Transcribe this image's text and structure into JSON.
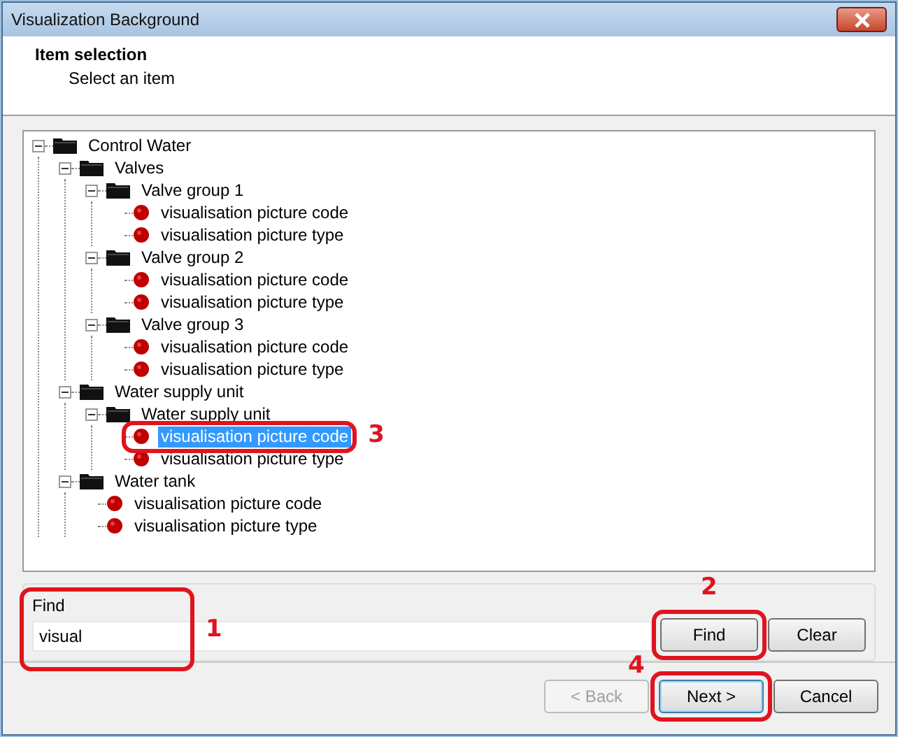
{
  "window": {
    "title": "Visualization Background"
  },
  "header": {
    "title": "Item selection",
    "subtitle": "Select an item"
  },
  "tree": [
    {
      "label": "Control Water",
      "kind": "folder",
      "expanded": true,
      "selected": false,
      "children": [
        {
          "label": "Valves",
          "kind": "folder",
          "expanded": true,
          "selected": false,
          "children": [
            {
              "label": "Valve group 1",
              "kind": "folder",
              "expanded": true,
              "selected": false,
              "children": [
                {
                  "label": "visualisation picture code",
                  "kind": "item",
                  "selected": false
                },
                {
                  "label": "visualisation picture type",
                  "kind": "item",
                  "selected": false
                }
              ]
            },
            {
              "label": "Valve group 2",
              "kind": "folder",
              "expanded": true,
              "selected": false,
              "children": [
                {
                  "label": "visualisation picture code",
                  "kind": "item",
                  "selected": false
                },
                {
                  "label": "visualisation picture type",
                  "kind": "item",
                  "selected": false
                }
              ]
            },
            {
              "label": "Valve group 3",
              "kind": "folder",
              "expanded": true,
              "selected": false,
              "children": [
                {
                  "label": "visualisation picture code",
                  "kind": "item",
                  "selected": false
                },
                {
                  "label": "visualisation picture type",
                  "kind": "item",
                  "selected": false
                }
              ]
            }
          ]
        },
        {
          "label": "Water supply unit",
          "kind": "folder",
          "expanded": true,
          "selected": false,
          "children": [
            {
              "label": "Water supply unit",
              "kind": "folder",
              "expanded": true,
              "selected": false,
              "children": [
                {
                  "label": "visualisation picture code",
                  "kind": "item",
                  "selected": true,
                  "callout": "3"
                },
                {
                  "label": "visualisation picture type",
                  "kind": "item",
                  "selected": false
                }
              ]
            }
          ]
        },
        {
          "label": "Water tank",
          "kind": "folder",
          "expanded": true,
          "selected": false,
          "children": [
            {
              "label": "visualisation picture code",
              "kind": "item",
              "selected": false
            },
            {
              "label": "visualisation picture type",
              "kind": "item",
              "selected": false
            }
          ]
        }
      ]
    }
  ],
  "find": {
    "label": "Find",
    "value": "visual",
    "callout": "1",
    "buttons": [
      {
        "label": "Find",
        "callout": "2"
      },
      {
        "label": "Clear"
      }
    ]
  },
  "footer": {
    "buttons": [
      {
        "label": "< Back",
        "disabled": true,
        "default": false
      },
      {
        "label": "Next >",
        "disabled": false,
        "default": true,
        "callout": "4"
      },
      {
        "label": "Cancel",
        "disabled": false,
        "default": false
      }
    ]
  }
}
